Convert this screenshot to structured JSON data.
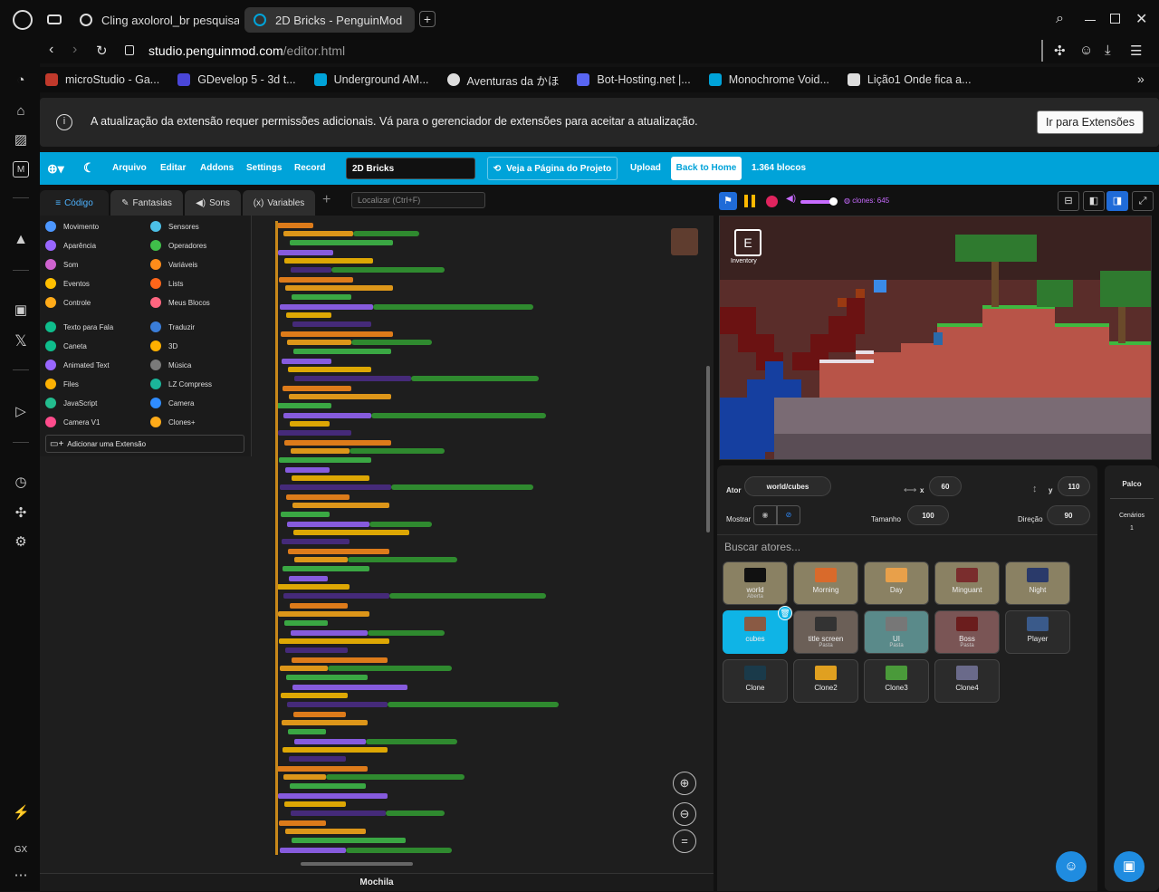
{
  "browser": {
    "tabs": [
      {
        "label": "Cling axolorol_br pesquisa",
        "active": false
      },
      {
        "label": "2D Bricks - PenguinMod",
        "active": true
      }
    ],
    "url_host": "studio.penguinmod.com",
    "url_path": "/editor.html",
    "bookmarks": [
      {
        "label": "microStudio - Ga...",
        "color": "#c0392b"
      },
      {
        "label": "GDevelop 5 - 3d t...",
        "color": "#4a46d8"
      },
      {
        "label": "Underground AM...",
        "color": "#00a3d9"
      },
      {
        "label": "Aventuras da かほ",
        "color": "#dddddd"
      },
      {
        "label": "Bot-Hosting.net |...",
        "color": "#5865f2"
      },
      {
        "label": "Monochrome Void...",
        "color": "#00a3d9"
      },
      {
        "label": "Lição1 Onde fica a...",
        "color": "#dddddd"
      }
    ],
    "sidebar_bottom_label": "GX"
  },
  "notice": {
    "text": "A atualização da extensão requer permissões adicionais. Vá para o gerenciador de extensões para aceitar a atualização.",
    "button": "Ir para Extensões"
  },
  "menu": {
    "items": [
      "Arquivo",
      "Editar",
      "Addons",
      "Settings",
      "Record"
    ],
    "project_title": "2D Bricks",
    "project_page": "Veja a Página do Projeto",
    "upload": "Upload",
    "back_home": "Back to Home",
    "blocks_count": "1.364 blocos"
  },
  "editor_tabs": {
    "code": "Código",
    "costumes": "Fantasias",
    "sounds": "Sons",
    "variables": "Variables",
    "search_placeholder": "Localizar (Ctrl+F)"
  },
  "categories": [
    {
      "label": "Movimento",
      "color": "#4c97ff"
    },
    {
      "label": "Sensores",
      "color": "#4cbfe6"
    },
    {
      "label": "Aparência",
      "color": "#9966ff"
    },
    {
      "label": "Operadores",
      "color": "#40bf4a"
    },
    {
      "label": "Som",
      "color": "#cf63cf"
    },
    {
      "label": "Variáveis",
      "color": "#ff8c1a"
    },
    {
      "label": "Eventos",
      "color": "#ffbf00"
    },
    {
      "label": "Lists",
      "color": "#ff661a"
    },
    {
      "label": "Controle",
      "color": "#ffab19"
    },
    {
      "label": "Meus Blocos",
      "color": "#ff6680"
    },
    {
      "label": "Texto para Fala",
      "color": "#0fbd8c"
    },
    {
      "label": "Traduzir",
      "color": "#3a7dd8"
    },
    {
      "label": "Caneta",
      "color": "#0fbd8c"
    },
    {
      "label": "3D",
      "color": "#ffb000"
    },
    {
      "label": "Animated Text",
      "color": "#9966ff"
    },
    {
      "label": "Música",
      "color": "#7a7a7a"
    },
    {
      "label": "Files",
      "color": "#fcb103"
    },
    {
      "label": "LZ Compress",
      "color": "#1bb59a"
    },
    {
      "label": "JavaScript",
      "color": "#23bc8e"
    },
    {
      "label": "Camera",
      "color": "#2f8cff"
    },
    {
      "label": "Camera V1",
      "color": "#ff4c8c"
    },
    {
      "label": "Clones+",
      "color": "#ffab19"
    }
  ],
  "add_extension": "Adicionar uma Extensão",
  "backpack": "Mochila",
  "stage_header": {
    "clones_label": "clones: 645"
  },
  "game": {
    "inventory_key": "E",
    "inventory_label": "Inventory"
  },
  "sprite_info": {
    "actor_label": "Ator",
    "actor_name": "world/cubes",
    "x_label": "x",
    "x_value": "60",
    "y_label": "y",
    "y_value": "110",
    "show_label": "Mostrar",
    "size_label": "Tamanho",
    "size_value": "100",
    "direction_label": "Direção",
    "direction_value": "90",
    "search_placeholder": "Buscar atores..."
  },
  "sprites": [
    {
      "name": "world",
      "sub": "Aberta",
      "color": "#111111"
    },
    {
      "name": "Morning",
      "sub": "",
      "color": "#d96a2b"
    },
    {
      "name": "Day",
      "sub": "",
      "color": "#e8a04a"
    },
    {
      "name": "Minguant",
      "sub": "",
      "color": "#7a2d2d"
    },
    {
      "name": "Night",
      "sub": "",
      "color": "#2a3a6a"
    },
    {
      "name": "cubes",
      "sub": "",
      "color": "#8a5a44"
    },
    {
      "name": "title screen",
      "sub": "Pasta",
      "color": "#333333"
    },
    {
      "name": "UI",
      "sub": "Pasta",
      "color": "#777777"
    },
    {
      "name": "Boss",
      "sub": "Pasta",
      "color": "#6b1d1d"
    },
    {
      "name": "Player",
      "sub": "",
      "color": "#3a5a8a"
    },
    {
      "name": "Clone",
      "sub": "",
      "color": "#1a3a4a"
    },
    {
      "name": "Clone2",
      "sub": "",
      "color": "#e0a020"
    },
    {
      "name": "Clone3",
      "sub": "",
      "color": "#4a9a3a"
    },
    {
      "name": "Clone4",
      "sub": "",
      "color": "#6a6a8a"
    }
  ],
  "stage_panel": {
    "title": "Palco",
    "backdrops_label": "Cenários",
    "backdrops_count": "1"
  }
}
